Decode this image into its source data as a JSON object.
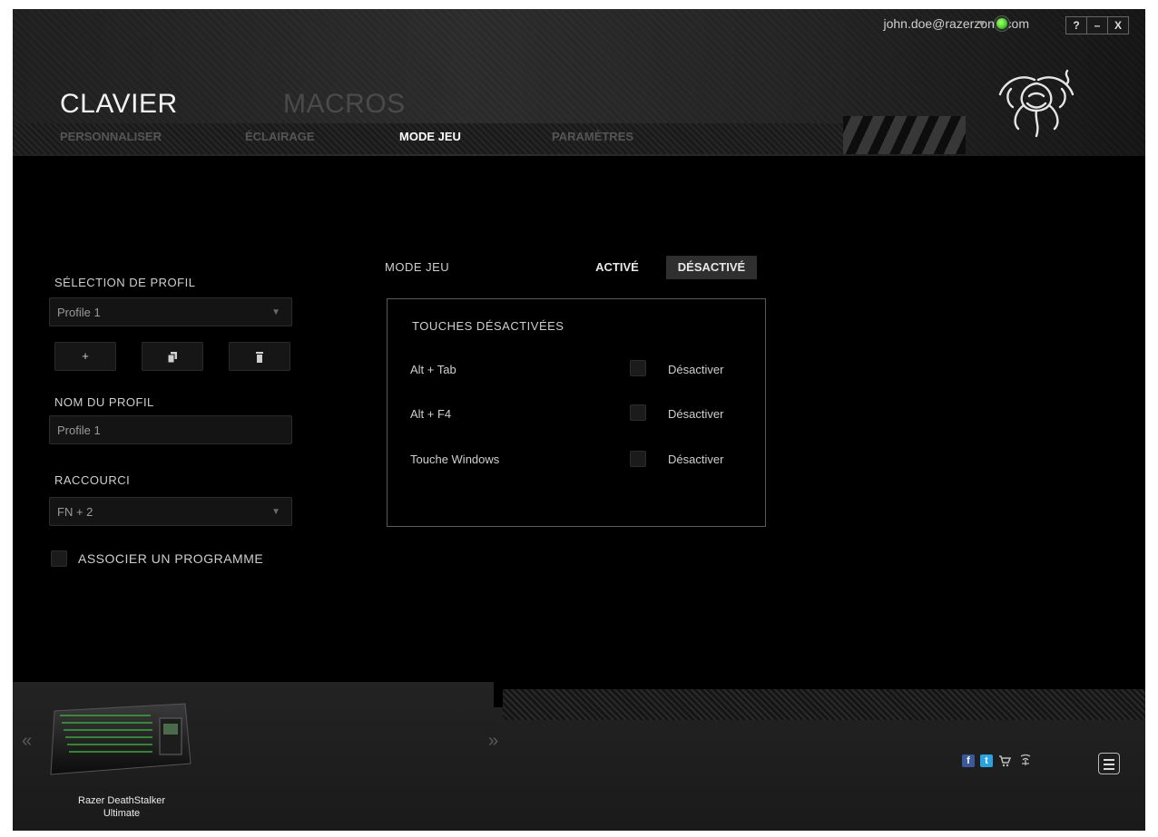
{
  "header": {
    "account_email": "john.doe@razerzone.com",
    "window_buttons": [
      "?",
      "–",
      "X"
    ],
    "main_tabs": [
      {
        "label": "CLAVIER",
        "active": true
      },
      {
        "label": "MACROS",
        "active": false
      }
    ],
    "sub_tabs": [
      {
        "label": "PERSONNALISER",
        "active": false
      },
      {
        "label": "ÉCLAIRAGE",
        "active": false
      },
      {
        "label": "MODE JEU",
        "active": true
      },
      {
        "label": "PARAMÈTRES",
        "active": false
      }
    ]
  },
  "profile": {
    "section_label": "SÉLECTION DE PROFIL",
    "selected_profile": "Profile 1",
    "add_label": "+",
    "name_label": "NOM DU PROFIL",
    "name_value": "Profile 1",
    "shortcut_label": "RACCOURCI",
    "shortcut_value": "FN + 2",
    "link_program_label": "ASSOCIER UN PROGRAMME"
  },
  "game_mode": {
    "label": "MODE JEU",
    "on_label": "ACTIVÉ",
    "off_label": "DÉSACTIVÉ",
    "state": "off",
    "panel_title": "TOUCHES DÉSACTIVÉES",
    "keys": [
      {
        "label": "Alt + Tab",
        "action": "Désactiver",
        "checked": false
      },
      {
        "label": "Alt + F4",
        "action": "Désactiver",
        "checked": false
      },
      {
        "label": "Touche Windows",
        "action": "Désactiver",
        "checked": false
      }
    ]
  },
  "footer": {
    "device_name_line1": "Razer DeathStalker",
    "device_name_line2": "Ultimate",
    "prev_arrow": "«",
    "next_arrow": "»",
    "facebook": "f",
    "twitter": "t"
  },
  "colors": {
    "accent_green": "#44d62c",
    "facebook_blue": "#3b5998",
    "twitter_blue": "#2aa3e0"
  }
}
